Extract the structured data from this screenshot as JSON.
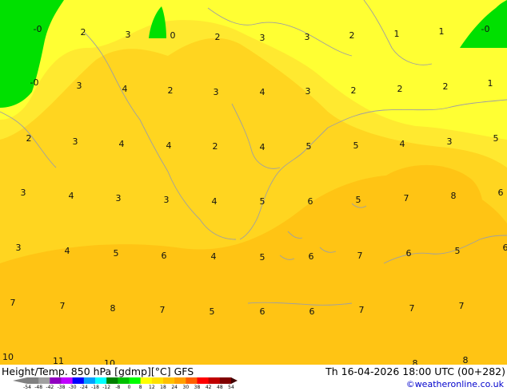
{
  "header": {
    "left": "Height/Temp. 850 hPa [gdmp][°C] GFS",
    "right": "Th 16-04-2026 18:00 UTC (00+282)",
    "credit": "©weatheronline.co.uk"
  },
  "legend": {
    "ticks": [
      "-54",
      "-48",
      "-42",
      "-38",
      "-30",
      "-24",
      "-18",
      "-12",
      "-8",
      "0",
      "8",
      "12",
      "18",
      "24",
      "30",
      "38",
      "42",
      "48",
      "54"
    ],
    "colors": [
      "#808080",
      "#a0a0a0",
      "#9000c0",
      "#c000ff",
      "#0000ff",
      "#00a0ff",
      "#00ffff",
      "#008000",
      "#00c000",
      "#00ff00",
      "#ffff00",
      "#ffe000",
      "#ffc000",
      "#ffa000",
      "#ff6000",
      "#ff0000",
      "#c00000",
      "#800000"
    ]
  },
  "map": {
    "colors": {
      "warm_light": "#ffe930",
      "warm_mid": "#ffd520",
      "warm_deep": "#ffc414",
      "cool": "#00e000",
      "yellow": "#ffff33",
      "coast": "#a0a0a0"
    },
    "values": [
      [
        "-0",
        47,
        36
      ],
      [
        "2",
        104,
        40
      ],
      [
        "3",
        160,
        43
      ],
      [
        "0",
        216,
        44
      ],
      [
        "2",
        272,
        46
      ],
      [
        "3",
        328,
        47
      ],
      [
        "3",
        384,
        46
      ],
      [
        "2",
        440,
        44
      ],
      [
        "1",
        496,
        42
      ],
      [
        "1",
        552,
        39
      ],
      [
        "-0",
        607,
        36
      ],
      [
        "-0",
        43,
        103
      ],
      [
        "3",
        99,
        107
      ],
      [
        "4",
        156,
        111
      ],
      [
        "2",
        213,
        113
      ],
      [
        "3",
        270,
        115
      ],
      [
        "4",
        328,
        115
      ],
      [
        "3",
        385,
        114
      ],
      [
        "2",
        442,
        113
      ],
      [
        "2",
        500,
        111
      ],
      [
        "2",
        557,
        108
      ],
      [
        "1",
        613,
        104
      ],
      [
        "2",
        36,
        173
      ],
      [
        "3",
        94,
        177
      ],
      [
        "4",
        152,
        180
      ],
      [
        "4",
        211,
        182
      ],
      [
        "2",
        269,
        183
      ],
      [
        "4",
        328,
        184
      ],
      [
        "5",
        386,
        183
      ],
      [
        "5",
        445,
        182
      ],
      [
        "4",
        503,
        180
      ],
      [
        "3",
        562,
        177
      ],
      [
        "5",
        620,
        173
      ],
      [
        "3",
        29,
        241
      ],
      [
        "4",
        89,
        245
      ],
      [
        "3",
        148,
        248
      ],
      [
        "3",
        208,
        250
      ],
      [
        "4",
        268,
        252
      ],
      [
        "5",
        328,
        252
      ],
      [
        "6",
        388,
        252
      ],
      [
        "5",
        448,
        250
      ],
      [
        "7",
        508,
        248
      ],
      [
        "8",
        567,
        245
      ],
      [
        "6",
        626,
        241
      ],
      [
        "3",
        23,
        310
      ],
      [
        "4",
        84,
        314
      ],
      [
        "5",
        145,
        317
      ],
      [
        "6",
        205,
        320
      ],
      [
        "4",
        267,
        321
      ],
      [
        "5",
        328,
        322
      ],
      [
        "6",
        389,
        321
      ],
      [
        "7",
        450,
        320
      ],
      [
        "6",
        511,
        317
      ],
      [
        "5",
        572,
        314
      ],
      [
        "6",
        632,
        310
      ],
      [
        "7",
        16,
        379
      ],
      [
        "7",
        78,
        383
      ],
      [
        "8",
        141,
        386
      ],
      [
        "7",
        203,
        388
      ],
      [
        "5",
        265,
        390
      ],
      [
        "6",
        328,
        390
      ],
      [
        "6",
        390,
        390
      ],
      [
        "7",
        452,
        388
      ],
      [
        "7",
        515,
        386
      ],
      [
        "7",
        577,
        383
      ],
      [
        "10",
        10,
        447
      ],
      [
        "11",
        73,
        452
      ],
      [
        "10",
        137,
        455
      ],
      [
        "8",
        582,
        451
      ],
      [
        "8",
        519,
        455
      ]
    ]
  }
}
